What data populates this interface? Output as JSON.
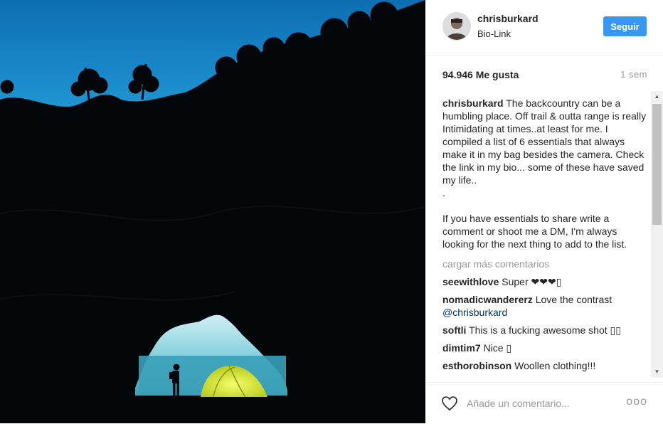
{
  "post": {
    "username": "chrisburkard",
    "location": "Bio-Link",
    "follow_label": "Seguir",
    "likes": "94.946 Me gusta",
    "time": "1 sem",
    "caption_user": "chrisburkard",
    "caption_text": " The backcountry can be a humbling place. Off trail & outta range is really Intimidating at times..at least for me. I compiled a list of 6 essentials that always make it in my bag besides the camera. Check the link in my bio... some of these have saved my life..\n.\n\nIf you have essentials to share write a comment or shoot me a DM, I'm always looking for the next thing to add to the list.",
    "load_more": "cargar más comentarios",
    "comments": [
      {
        "user": "seewithlove",
        "text": " Super ❤❤❤▯",
        "mention": ""
      },
      {
        "user": "nomadicwandererz",
        "text": " Love the contrast ",
        "mention": "@chrisburkard"
      },
      {
        "user": "softli",
        "text": " This is a fucking awesome shot ▯▯",
        "mention": ""
      },
      {
        "user": "dimtim7",
        "text": " Nice ▯",
        "mention": ""
      },
      {
        "user": "esthorobinson",
        "text": " Woollen clothing!!!",
        "mention": ""
      }
    ]
  },
  "footer": {
    "comment_placeholder": "Añade un comentario...",
    "more_label": "ooo"
  },
  "icons": {
    "like": "heart-outline-icon",
    "more": "more-options-icon",
    "scroll_up": "scroll-up-arrow-icon",
    "scroll_down": "scroll-down-arrow-icon"
  },
  "colors": {
    "follow_button": "#3897f0",
    "sky": "#1a7fc0",
    "tent": "#e4f02e",
    "sea": "#3aa0b8"
  }
}
